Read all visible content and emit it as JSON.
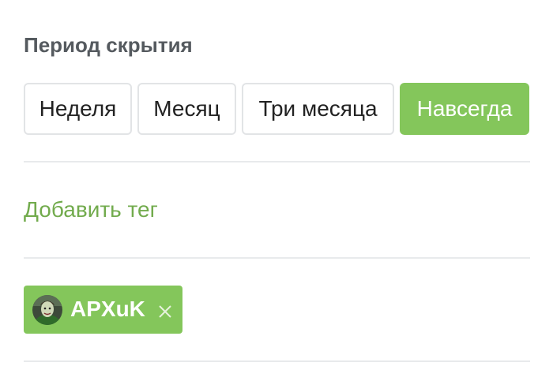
{
  "section": {
    "title": "Период скрытия"
  },
  "period_options": [
    {
      "label": "Неделя",
      "selected": false
    },
    {
      "label": "Месяц",
      "selected": false
    },
    {
      "label": "Три месяца",
      "selected": false
    },
    {
      "label": "Навсегда",
      "selected": true
    }
  ],
  "add_tag": {
    "label": "Добавить тег"
  },
  "tags": [
    {
      "name": "APXuK",
      "avatar_icon": "user-avatar",
      "remove_icon": "close-icon"
    }
  ],
  "colors": {
    "accent": "#84c65b",
    "link": "#72ab4d",
    "divider": "#e8eaec",
    "button_border": "#e2e4e6",
    "title": "#555a5f"
  }
}
